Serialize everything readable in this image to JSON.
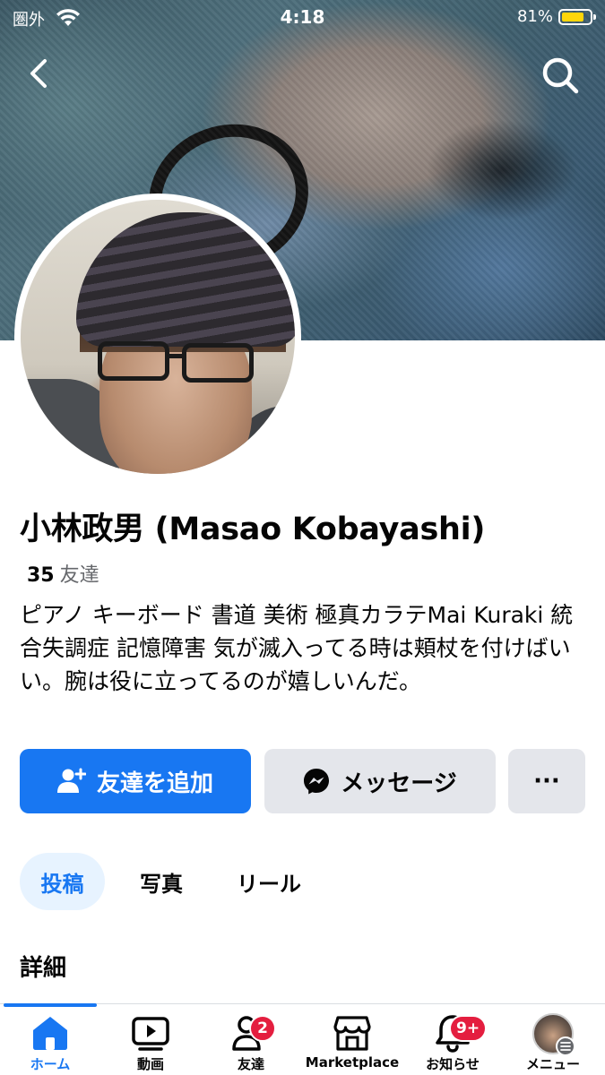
{
  "status_bar": {
    "carrier": "圏外",
    "time": "4:18",
    "battery": "81%",
    "battery_level": 0.81
  },
  "header": {
    "back_icon": "chevron-left-icon",
    "search_icon": "search-icon"
  },
  "profile": {
    "name": "小林政男 (Masao Kobayashi)",
    "friends_count": "35",
    "friends_label": "友達",
    "bio": "ピアノ キーボード 書道 美術 極真カラテMai Kuraki 統合失調症 記憶障害 気が滅入ってる時は頬杖を付けばいい。腕は役に立ってるのが嬉しいんだ。"
  },
  "actions": {
    "add_friend": "友達を追加",
    "message": "メッセージ",
    "more": "···"
  },
  "tabs": [
    {
      "label": "投稿",
      "active": true
    },
    {
      "label": "写真",
      "active": false
    },
    {
      "label": "リール",
      "active": false
    }
  ],
  "details_heading": "詳細",
  "bottom_nav": [
    {
      "label": "ホーム",
      "icon": "home-icon",
      "active": true
    },
    {
      "label": "動画",
      "icon": "video-icon",
      "active": false
    },
    {
      "label": "友達",
      "icon": "friends-icon",
      "active": false,
      "badge": "2"
    },
    {
      "label": "Marketplace",
      "icon": "marketplace-icon",
      "active": false
    },
    {
      "label": "お知らせ",
      "icon": "bell-icon",
      "active": false,
      "badge": "9+"
    },
    {
      "label": "メニュー",
      "icon": "menu-avatar-icon",
      "active": false
    }
  ],
  "colors": {
    "accent": "#1877f2",
    "badge": "#e41e3f",
    "secondary_button": "#e4e6eb"
  }
}
